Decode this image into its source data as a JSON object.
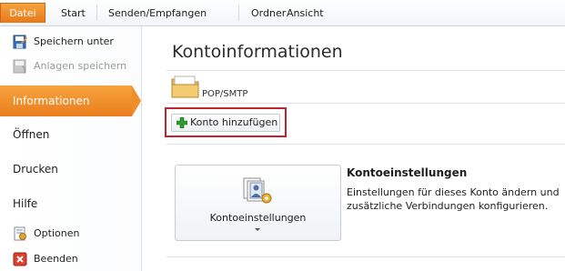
{
  "ribbon": {
    "tabs": [
      {
        "label": "Datei"
      },
      {
        "label": "Start"
      },
      {
        "label": "Senden/Empfangen"
      },
      {
        "label": "Ordner"
      },
      {
        "label": "Ansicht"
      }
    ]
  },
  "backstage_nav": {
    "commands_top": [
      {
        "label": "Speichern unter",
        "icon": "save-as-icon",
        "enabled": true
      },
      {
        "label": "Anlagen speichern",
        "icon": "save-attachments-icon",
        "enabled": false
      }
    ],
    "tabs": [
      {
        "label": "Informationen",
        "selected": true
      },
      {
        "label": "Öffnen"
      },
      {
        "label": "Drucken"
      },
      {
        "label": "Hilfe"
      }
    ],
    "commands_bottom": [
      {
        "label": "Optionen",
        "icon": "options-icon"
      },
      {
        "label": "Beenden",
        "icon": "exit-icon"
      }
    ]
  },
  "main": {
    "title": "Kontoinformationen",
    "account_selector": {
      "label": "POP/SMTP",
      "icon": "account-folder-icon"
    },
    "add_account_button": {
      "label": "Konto hinzufügen",
      "icon": "plus-icon"
    },
    "account_settings": {
      "button_label": "Kontoeinstellungen",
      "icon": "account-settings-icon",
      "heading": "Kontoeinstellungen",
      "description": "Einstellungen für dieses Konto ändern und zusätzliche Verbindungen konfigurieren."
    }
  },
  "colors": {
    "accent_orange": "#ea7d1d",
    "highlight_red": "#c0232c",
    "plus_green": "#2f9b2f"
  }
}
